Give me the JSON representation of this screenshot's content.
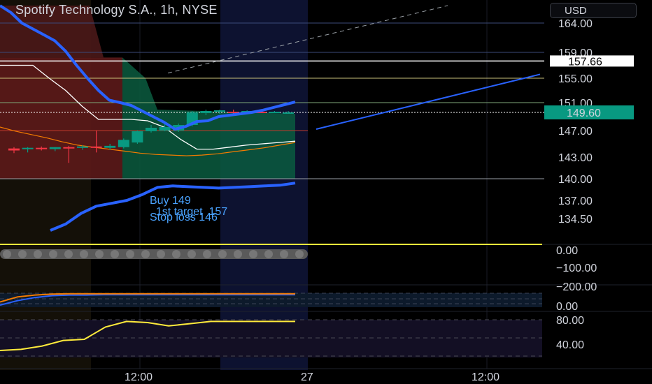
{
  "header": {
    "title": "Spotify Technology S.A., 1h, NYSE",
    "currency": "USD"
  },
  "annotation": {
    "line1": "Buy 149",
    "line2": "  1st target  157",
    "line3": "Stop loss 146"
  },
  "price_labels": {
    "last": "149.60",
    "marker": "157.66"
  },
  "colors": {
    "up": "#089981",
    "down": "#f23645",
    "blue": "#2962ff",
    "orange": "#f57c00",
    "yellow": "#ffeb3b",
    "profit_zone": "#0b5c3f",
    "loss_zone": "#5c1a1a"
  },
  "chart_data": [
    {
      "type": "candlestick",
      "title": "Spotify Technology S.A., 1h, NYSE",
      "ylim": [
        133,
        166
      ],
      "y_ticks": [
        164.0,
        159.0,
        155.0,
        151.0,
        147.0,
        143.0,
        140.0,
        137.0,
        134.5
      ],
      "x_ticks": [
        "12:00",
        "27",
        "12:00"
      ],
      "candles": [
        {
          "o": 144.3,
          "h": 144.5,
          "l": 143.6,
          "c": 144.0
        },
        {
          "o": 144.2,
          "h": 144.5,
          "l": 143.7,
          "c": 144.4
        },
        {
          "o": 144.4,
          "h": 144.6,
          "l": 144.0,
          "c": 144.2
        },
        {
          "o": 144.2,
          "h": 144.5,
          "l": 143.9,
          "c": 144.5
        },
        {
          "o": 144.5,
          "h": 144.7,
          "l": 142.2,
          "c": 144.3
        },
        {
          "o": 144.4,
          "h": 144.8,
          "l": 144.1,
          "c": 144.6
        },
        {
          "o": 144.6,
          "h": 147.0,
          "l": 143.7,
          "c": 144.4
        },
        {
          "o": 144.4,
          "h": 145.0,
          "l": 144.1,
          "c": 144.7
        },
        {
          "o": 144.5,
          "h": 145.8,
          "l": 144.3,
          "c": 145.6
        },
        {
          "o": 145.2,
          "h": 147.0,
          "l": 145.0,
          "c": 146.9
        },
        {
          "o": 146.9,
          "h": 147.8,
          "l": 146.7,
          "c": 147.4
        },
        {
          "o": 147.0,
          "h": 148.0,
          "l": 146.9,
          "c": 147.5
        },
        {
          "o": 147.0,
          "h": 148.0,
          "l": 146.8,
          "c": 147.8
        },
        {
          "o": 147.8,
          "h": 149.8,
          "l": 147.6,
          "c": 149.6
        },
        {
          "o": 149.5,
          "h": 150.0,
          "l": 149.2,
          "c": 149.8
        },
        {
          "o": 149.7,
          "h": 150.0,
          "l": 149.4,
          "c": 149.9
        },
        {
          "o": 149.7,
          "h": 150.0,
          "l": 149.4,
          "c": 149.6
        },
        {
          "o": 149.6,
          "h": 149.9,
          "l": 149.4,
          "c": 149.8
        },
        {
          "o": 149.7,
          "h": 149.9,
          "l": 149.5,
          "c": 149.6
        },
        {
          "o": 149.6,
          "h": 149.8,
          "l": 149.5,
          "c": 149.7
        },
        {
          "o": 149.6,
          "h": 149.8,
          "l": 149.5,
          "c": 149.6
        }
      ],
      "horizontal_levels": [
        164.0,
        159.0,
        157.66,
        155.0,
        151.0,
        149.6,
        147.0,
        140.0
      ],
      "ma_blue_top": [
        166.2,
        165.2,
        164.0,
        163.0,
        162.0,
        161.0,
        159.2,
        157.0,
        155.0,
        153.0,
        151.4,
        151.0,
        150.6,
        149.8,
        149.0,
        148.2,
        147.2,
        147.6,
        148.3,
        148.4,
        149.0,
        149.2,
        149.4,
        149.6,
        149.9,
        150.3,
        150.7,
        151.1
      ],
      "ma_blue_bottom": [
        133.0,
        133.8,
        135.2,
        136.2,
        136.6,
        137.0,
        137.8,
        138.8,
        139.0,
        138.9,
        138.8,
        138.7,
        138.8,
        138.9,
        139.0,
        139.1,
        139.4
      ],
      "projection": [
        {
          "x": 0,
          "y": 147.2
        },
        {
          "x": 1,
          "y": 155.6
        }
      ],
      "white_line": [
        157.0,
        157.0,
        157.0,
        155.0,
        153.0,
        150.5,
        148.6,
        148.6,
        148.6,
        148.4,
        147.5,
        145.7,
        144.2,
        144.2,
        144.5,
        144.8,
        145.0,
        145.2,
        145.4
      ],
      "orange_line": [
        147.5,
        146.9,
        146.4,
        145.9,
        145.3,
        144.8,
        144.5,
        144.2,
        143.9,
        143.6,
        143.4,
        143.3,
        143.2,
        143.3,
        143.5,
        143.8,
        144.1,
        144.4,
        144.8,
        145.2
      ]
    },
    {
      "type": "line",
      "y_ticks": [
        "0.00",
        "−100.00",
        "−200.00"
      ],
      "series": [
        {
          "values": [
            0,
            0,
            0,
            0,
            0,
            0,
            0,
            0,
            0,
            0,
            0,
            0,
            0,
            0,
            0,
            0,
            0,
            0,
            0,
            0
          ]
        }
      ]
    },
    {
      "type": "line",
      "y_ticks": [
        "0.00"
      ],
      "series": [
        {
          "values": [
            -30,
            -14,
            -8,
            -5,
            -4,
            -4,
            -4,
            -4,
            -4,
            -4,
            -4,
            -4,
            -4,
            -4,
            -4,
            -4,
            -4,
            -4
          ]
        },
        {
          "values": [
            -40,
            -26,
            -16,
            -10,
            -8,
            -8,
            -7,
            -7,
            -7,
            -7,
            -7,
            -7,
            -7,
            -7,
            -7,
            -7,
            -7,
            -7
          ]
        }
      ]
    },
    {
      "type": "line",
      "y_ticks": [
        "80.00",
        "40.00"
      ],
      "series": [
        {
          "values": [
            35,
            36,
            39,
            44,
            45,
            56,
            61,
            60,
            57,
            59,
            61,
            61,
            61,
            61,
            61
          ]
        }
      ]
    }
  ]
}
